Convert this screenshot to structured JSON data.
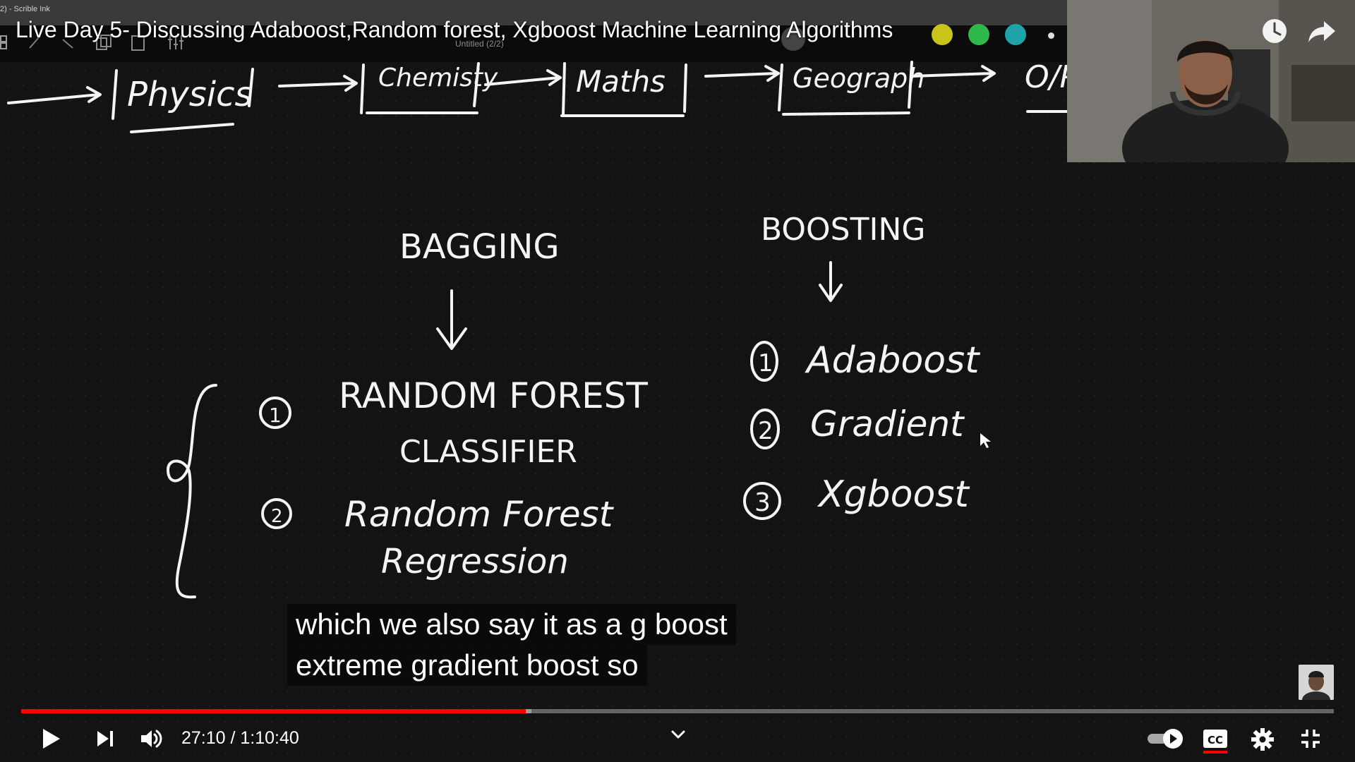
{
  "app": {
    "name": "2) - Scrible Ink",
    "document_name": "Untitled (2/2)",
    "pen_colors": [
      "#c9c31a",
      "#2fb94a",
      "#1ea3a8"
    ]
  },
  "video": {
    "title": "Live Day 5- Discussing Adaboost,Random forest, Xgboost Machine Learning Algorithms"
  },
  "whiteboard": {
    "top_row": [
      "Physics",
      "Chemisty",
      "Maths",
      "Geograph",
      "O/P"
    ],
    "bagging": {
      "heading": "BAGGING",
      "items": [
        {
          "num": "1",
          "line1": "RANDOM FOREST",
          "line2": "CLASSIFIER"
        },
        {
          "num": "2",
          "line1": "Random Forest",
          "line2": "Regression"
        }
      ]
    },
    "boosting": {
      "heading": "BOOSTING",
      "items": [
        {
          "num": "1",
          "label": "Adaboost"
        },
        {
          "num": "2",
          "label": "Gradient"
        },
        {
          "num": "3",
          "label": "Xgboost"
        }
      ]
    }
  },
  "captions": {
    "line1": "which we also say it as a g boost",
    "line2": "extreme gradient boost so"
  },
  "player": {
    "current_time": "27:10",
    "duration": "1:10:40",
    "time_text": "27:10 / 1:10:40",
    "progress_fraction": 0.3842,
    "buffered_fraction": 0.3885,
    "accent_color": "#ff0000"
  },
  "icons": {
    "play": "play-icon",
    "next": "next-icon",
    "volume": "volume-icon",
    "chevron": "chevron-down-icon",
    "autoplay": "autoplay-toggle-icon",
    "cc": "cc-icon",
    "settings": "gear-icon",
    "exit_fullscreen": "exit-fullscreen-icon",
    "watch_later": "clock-icon",
    "share": "share-icon"
  }
}
